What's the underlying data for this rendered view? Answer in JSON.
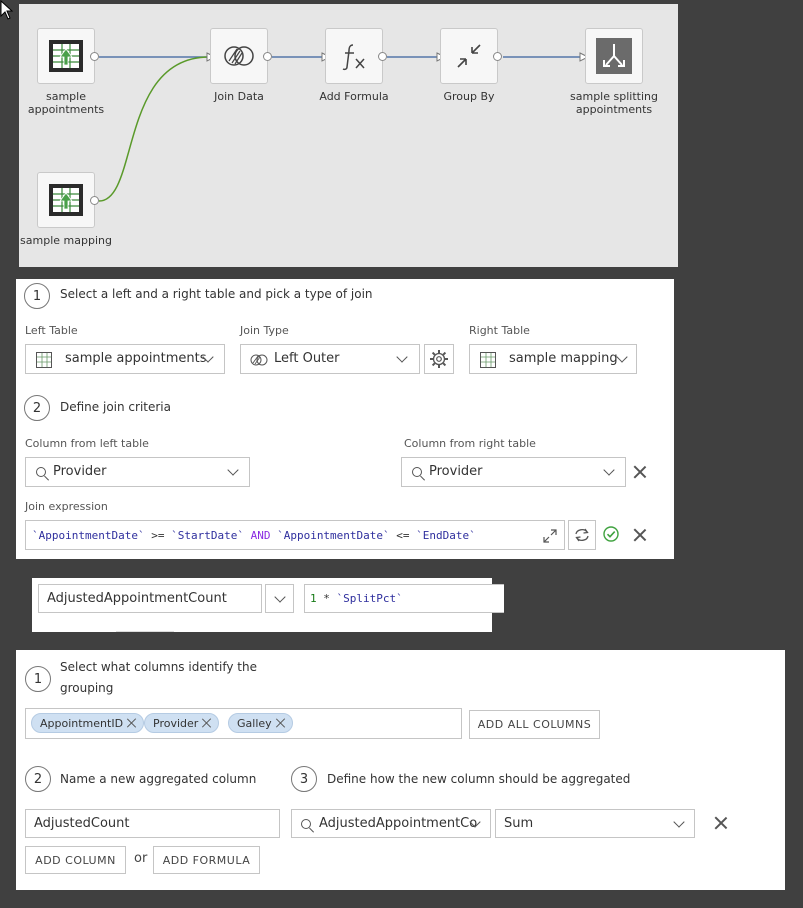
{
  "flow": {
    "nodes": [
      {
        "id": "sample-appointments",
        "label": "sample\nappointments",
        "icon": "table-icon"
      },
      {
        "id": "join-data",
        "label": "Join Data",
        "icon": "join-icon"
      },
      {
        "id": "add-formula",
        "label": "Add Formula",
        "icon": "formula-icon"
      },
      {
        "id": "group-by",
        "label": "Group By",
        "icon": "group-by-icon"
      },
      {
        "id": "sample-splitting-appointments",
        "label": "sample splitting\nappointments",
        "icon": "output-icon"
      },
      {
        "id": "sample-mapping",
        "label": "sample mapping",
        "icon": "table-icon"
      }
    ],
    "edge_colors": {
      "blue": "#5577a8",
      "green": "#5a9a2a"
    }
  },
  "join": {
    "step1_number": "1",
    "step1_text": "Select a left and a right table and pick a type of join",
    "left_table_label": "Left Table",
    "left_table_value": "sample appointments",
    "join_type_label": "Join Type",
    "join_type_value": "Left Outer",
    "right_table_label": "Right Table",
    "right_table_value": "sample mapping",
    "step2_number": "2",
    "step2_text": "Define join criteria",
    "left_col_label": "Column from left table",
    "left_col_value": "Provider",
    "right_col_label": "Column from right table",
    "right_col_value": "Provider",
    "expr_label": "Join expression",
    "expr_tokens": [
      {
        "t": "`AppointmentDate`",
        "k": "ident"
      },
      {
        "t": " >= ",
        "k": "op"
      },
      {
        "t": "`StartDate`",
        "k": "ident"
      },
      {
        "t": " AND ",
        "k": "kw"
      },
      {
        "t": "`AppointmentDate`",
        "k": "ident"
      },
      {
        "t": " <= ",
        "k": "op"
      },
      {
        "t": "`EndDate` ",
        "k": "ident"
      }
    ]
  },
  "formula": {
    "column_name": "AdjustedAppointmentCount",
    "expr_num": "1",
    "expr_op": " * ",
    "expr_ident": "`SplitPct`"
  },
  "groupby": {
    "step1_number": "1",
    "step1_text_line1": "Select what columns identify the",
    "step1_text_line2": "grouping",
    "chips": [
      "AppointmentID",
      "Provider",
      "Galley"
    ],
    "add_all_label": "ADD ALL COLUMNS",
    "step2_number": "2",
    "step2_text": "Name a new aggregated column",
    "step3_number": "3",
    "step3_text": "Define how the new column should be aggregated",
    "new_col_value": "AdjustedCount",
    "agg_source_value": "AdjustedAppointmentCo",
    "agg_fn_value": "Sum",
    "add_column_label": "ADD COLUMN",
    "or_label": "or",
    "add_formula_label": "ADD FORMULA"
  }
}
